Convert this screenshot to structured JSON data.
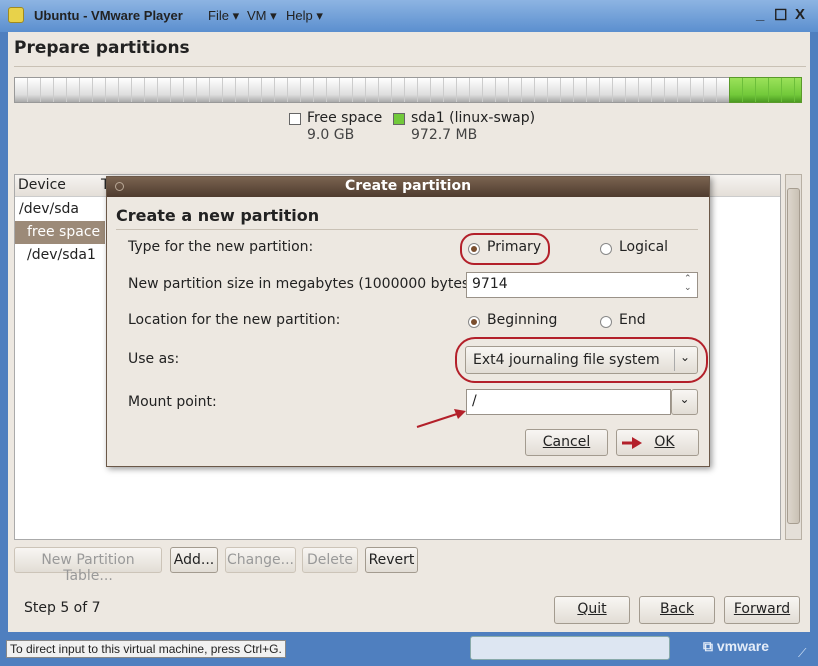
{
  "window": {
    "title": "Ubuntu - VMware Player",
    "menus": [
      "File",
      "VM",
      "Help"
    ],
    "minimize": "_",
    "maximize": "☐",
    "close": "X"
  },
  "page": {
    "title": "Prepare partitions"
  },
  "partition_bar": {
    "free_fraction": 0.907,
    "swap_fraction": 0.093,
    "colors": {
      "free": "#ffffff",
      "swap": "#72c93a"
    }
  },
  "legend": [
    {
      "name": "Free space",
      "size": "9.0 GB"
    },
    {
      "name": "sda1 (linux-swap)",
      "size": "972.7 MB"
    }
  ],
  "table": {
    "headers": [
      "Device",
      "T"
    ],
    "rows": [
      {
        "device": "/dev/sda"
      },
      {
        "device": "free space",
        "selected": true
      },
      {
        "device": "/dev/sda1"
      }
    ]
  },
  "buttons": {
    "new_table": "New Partition Table...",
    "add": "Add...",
    "change": "Change...",
    "delete": "Delete",
    "revert": "Revert"
  },
  "footer": {
    "step": "Step 5 of 7",
    "quit": "Quit",
    "back": "Back",
    "forward": "Forward"
  },
  "dialog": {
    "title": "Create partition",
    "heading": "Create a new partition",
    "type_label": "Type for the new partition:",
    "type_primary": "Primary",
    "type_logical": "Logical",
    "type_selected": "Primary",
    "size_label": "New partition size in megabytes (1000000 bytes):",
    "size_value": "9714",
    "location_label": "Location for the new partition:",
    "loc_beginning": "Beginning",
    "loc_end": "End",
    "loc_selected": "Beginning",
    "use_label": "Use as:",
    "use_value": "Ext4 journaling file system",
    "mount_label": "Mount point:",
    "mount_value": "/",
    "cancel": "Cancel",
    "ok": "OK"
  },
  "statusbar": {
    "hint": "To direct input to this virtual machine, press Ctrl+G.",
    "brand": "vmware"
  },
  "annotation_color": "#b3202a"
}
